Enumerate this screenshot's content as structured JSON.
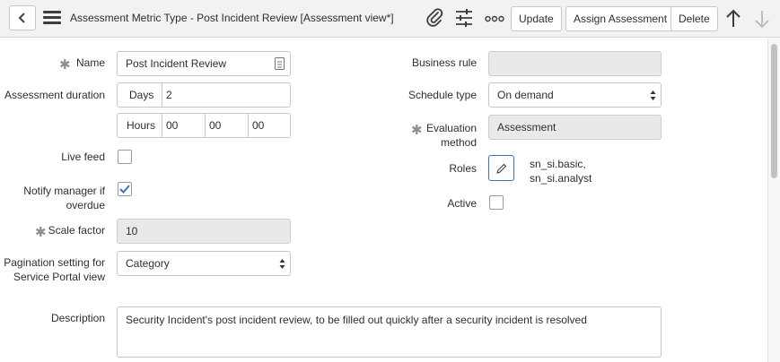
{
  "header": {
    "title": "Assessment Metric Type - Post Incident Review [Assessment view*]",
    "buttons": {
      "update": "Update",
      "assign": "Assign Assessment",
      "delete": "Delete"
    },
    "icons": [
      "back-icon",
      "menu-icon",
      "attachment-icon",
      "settings-sliders-icon",
      "more-options-icon",
      "arrow-up-icon",
      "arrow-down-icon"
    ]
  },
  "form": {
    "name": {
      "label": "Name",
      "value": "Post Incident Review",
      "required": true
    },
    "assessment_duration": {
      "label": "Assessment duration",
      "days_label": "Days",
      "days_value": "2",
      "hours_label": "Hours",
      "hours": "00",
      "minutes": "00",
      "seconds": "00"
    },
    "live_feed": {
      "label": "Live feed",
      "checked": false
    },
    "notify_manager": {
      "label": "Notify manager if overdue",
      "checked": true
    },
    "scale_factor": {
      "label": "Scale factor",
      "value": "10",
      "required": true
    },
    "pagination": {
      "label": "Pagination setting for Service Portal view",
      "value": "Category"
    },
    "description": {
      "label": "Description",
      "value": "Security Incident's post incident review, to be filled out quickly after a security incident is resolved"
    },
    "business_rule": {
      "label": "Business rule",
      "value": ""
    },
    "schedule_type": {
      "label": "Schedule type",
      "value": "On demand"
    },
    "evaluation_method": {
      "label": "Evaluation method",
      "value": "Assessment",
      "required": true
    },
    "roles": {
      "label": "Roles",
      "line1": "sn_si.basic,",
      "line2": "sn_si.analyst"
    },
    "active": {
      "label": "Active",
      "checked": false
    }
  },
  "colors": {
    "accent": "#3b73c5",
    "readonly_bg": "#e9e9e9",
    "header_bg": "#f2f2f2"
  }
}
